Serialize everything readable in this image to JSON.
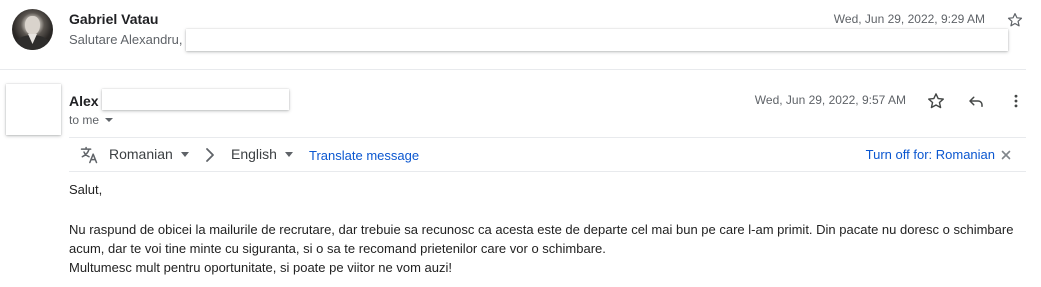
{
  "thread": {
    "message1": {
      "sender": "Gabriel Vatau",
      "snippet": "Salutare Alexandru,",
      "date": "Wed, Jun 29, 2022, 9:29 AM",
      "star_icon": "star-outline-icon"
    },
    "message2": {
      "sender": "Alex",
      "recipient_label": "to me",
      "date": "Wed, Jun 29, 2022, 9:57 AM",
      "icons": [
        "star-outline-icon",
        "reply-icon",
        "more-vert-icon"
      ],
      "translation_bar": {
        "from_language": "Romanian",
        "to_language": "English",
        "translate_label": "Translate message",
        "turn_off_label": "Turn off for: Romanian"
      },
      "body": {
        "greeting": "Salut,",
        "paragraph_line1": "Nu raspund de obicei la mailurile de recrutare, dar trebuie sa recunosc ca acesta este de departe cel mai bun pe care l-am primit. Din pacate nu doresc o schimbare acum, dar te voi tine minte cu siguranta, si o sa te recomand prietenilor care vor o schimbare.",
        "paragraph_line2": "Multumesc mult pentru oportunitate, si poate pe viitor ne vom auzi!"
      }
    }
  },
  "colors": {
    "link": "#0b57d0",
    "muted_text": "#5f6368",
    "divider": "#e8eaed"
  }
}
